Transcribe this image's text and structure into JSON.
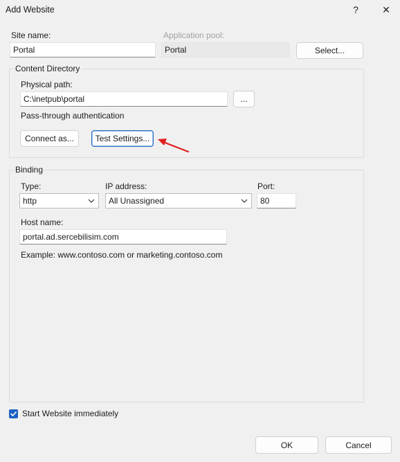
{
  "window": {
    "title": "Add Website",
    "help_glyph": "?",
    "close_glyph": "✕"
  },
  "site": {
    "label": "Site name:",
    "value": "Portal"
  },
  "app_pool": {
    "label": "Application pool:",
    "value": "Portal",
    "select_label": "Select..."
  },
  "content_dir": {
    "title": "Content Directory",
    "physical_path_label": "Physical path:",
    "physical_path_value": "C:\\inetpub\\portal",
    "browse_label": "...",
    "passthrough_label": "Pass-through authentication",
    "connect_as_label": "Connect as...",
    "test_settings_label": "Test Settings..."
  },
  "binding": {
    "title": "Binding",
    "type_label": "Type:",
    "type_value": "http",
    "ip_label": "IP address:",
    "ip_value": "All Unassigned",
    "port_label": "Port:",
    "port_value": "80",
    "host_label": "Host name:",
    "host_value": "portal.ad.sercebilisim.com",
    "example_text": "Example: www.contoso.com or marketing.contoso.com"
  },
  "start_immediately": {
    "label": "Start Website immediately",
    "checked": true
  },
  "footer": {
    "ok_label": "OK",
    "cancel_label": "Cancel"
  },
  "colors": {
    "accent": "#1e62c3",
    "annotation_arrow": "#e02020"
  }
}
